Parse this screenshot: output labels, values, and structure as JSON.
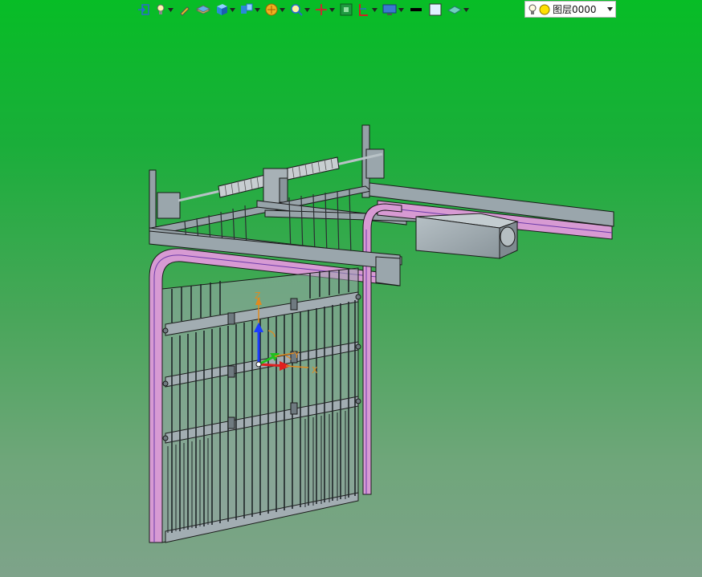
{
  "toolbar": {
    "layer_value": "图层0000",
    "buttons": [
      {
        "name": "exit-icon"
      },
      {
        "name": "light-icon"
      },
      {
        "name": "pen-icon"
      },
      {
        "name": "layer-plane-icon"
      },
      {
        "name": "solid-cube-icon"
      },
      {
        "name": "view-orient-icon"
      },
      {
        "name": "render-mode-icon"
      },
      {
        "name": "zoom-icon"
      },
      {
        "name": "move-icon"
      },
      {
        "name": "fit-view-icon"
      },
      {
        "name": "section-icon"
      },
      {
        "name": "display-icon"
      },
      {
        "name": "line-color-icon"
      },
      {
        "name": "fill-color-icon"
      },
      {
        "name": "surface-icon"
      }
    ]
  },
  "triad": {
    "x_label": "X",
    "y_label": "Y",
    "z_label": "Z"
  },
  "colors": {
    "background_top": "#07bd26",
    "background_bottom": "#7ea38a",
    "frame": "#8c979d",
    "track": "#d79ad3",
    "track_edge": "#6a3aa8",
    "outline": "#1a1a1a"
  }
}
